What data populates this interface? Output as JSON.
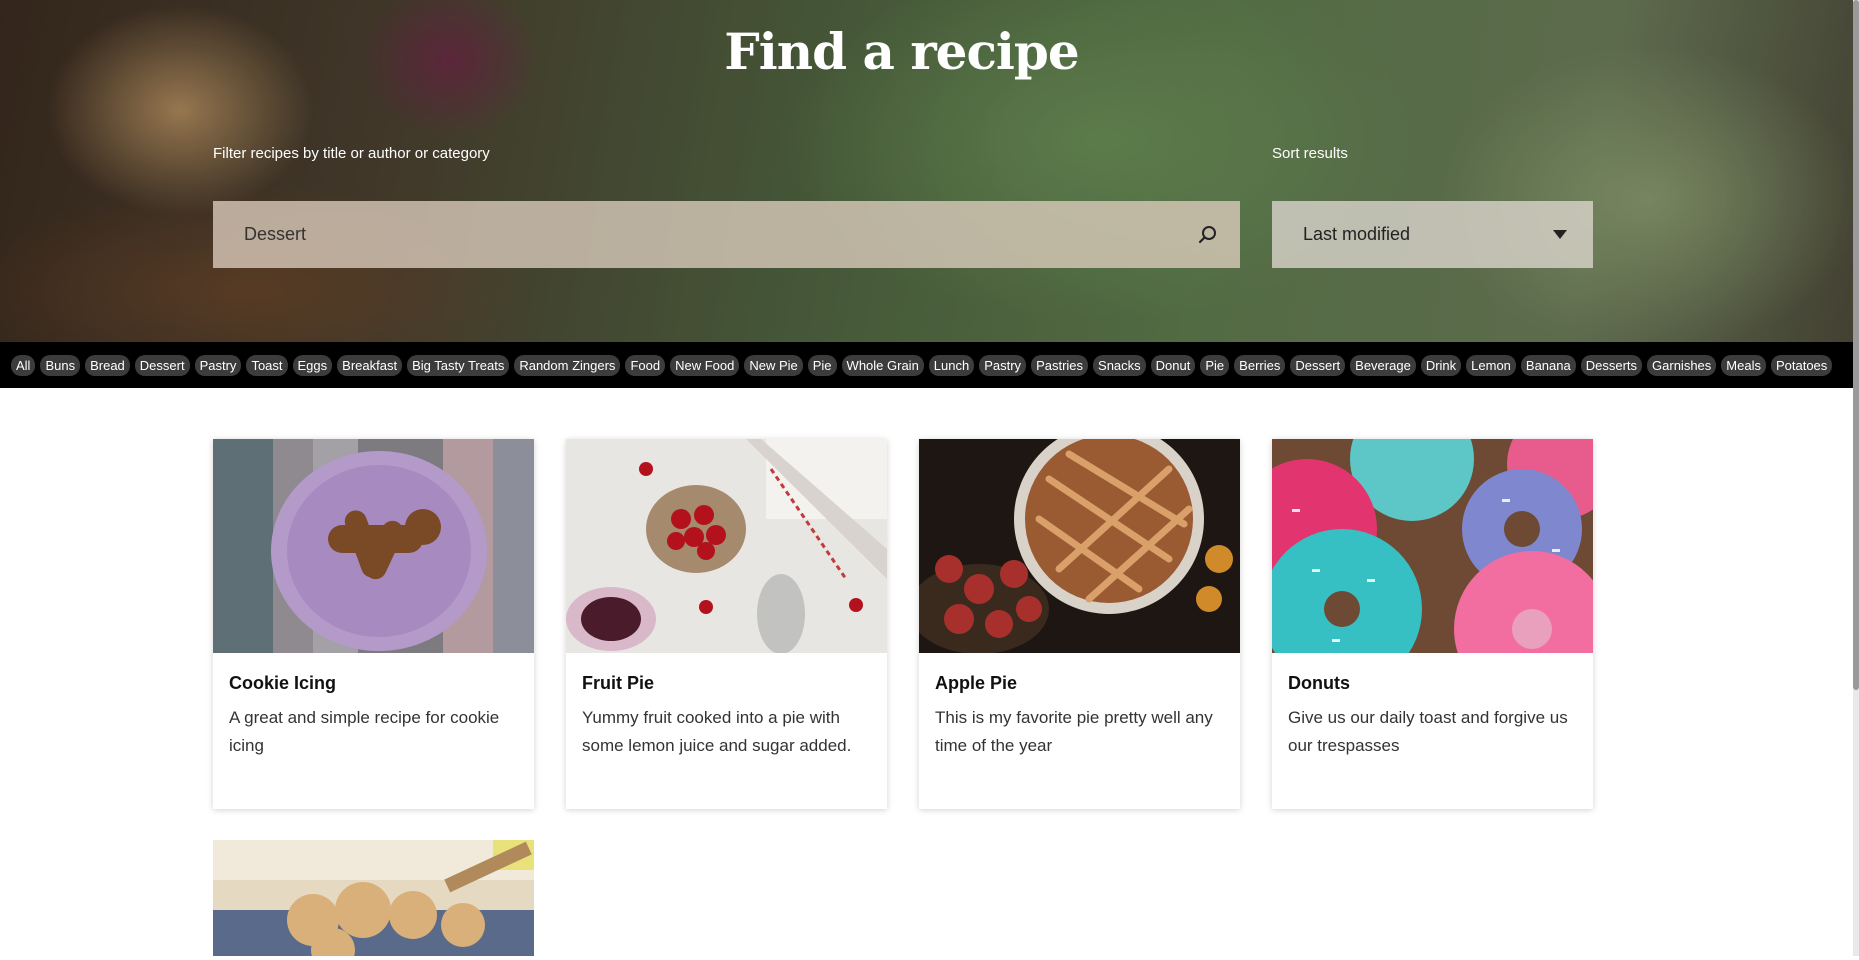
{
  "hero": {
    "title": "Find a recipe",
    "filter_label": "Filter recipes by title or author or category",
    "search_value": "Dessert",
    "sort_label": "Sort results",
    "sort_value": "Last modified"
  },
  "categories": [
    "All",
    "Buns",
    "Bread",
    "Dessert",
    "Pastry",
    "Toast",
    "Eggs",
    "Breakfast",
    "Big Tasty Treats",
    "Random Zingers",
    "Food",
    "New Food",
    "New Pie",
    "Pie",
    "Whole Grain",
    "Lunch",
    "Pastry",
    "Pastries",
    "Snacks",
    "Donut",
    "Pie",
    "Berries",
    "Dessert",
    "Beverage",
    "Drink",
    "Lemon",
    "Banana",
    "Desserts",
    "Garnishes",
    "Meals",
    "Potatoes"
  ],
  "recipes": [
    {
      "title": "Cookie Icing",
      "description": "A great and simple recipe for cookie icing",
      "image": "gingerbread-cookie-plate"
    },
    {
      "title": "Fruit Pie",
      "description": "Yummy fruit cooked into a pie with some lemon juice and sugar added.",
      "image": "cherries-bowl"
    },
    {
      "title": "Apple Pie",
      "description": "This is my favorite pie pretty well any time of the year",
      "image": "lattice-apple-pie"
    },
    {
      "title": "Donuts",
      "description": "Give us our daily toast and forgive us our trespasses",
      "image": "sprinkled-donuts"
    },
    {
      "title": "",
      "description": "",
      "image": "bread-rolls-basket"
    }
  ]
}
